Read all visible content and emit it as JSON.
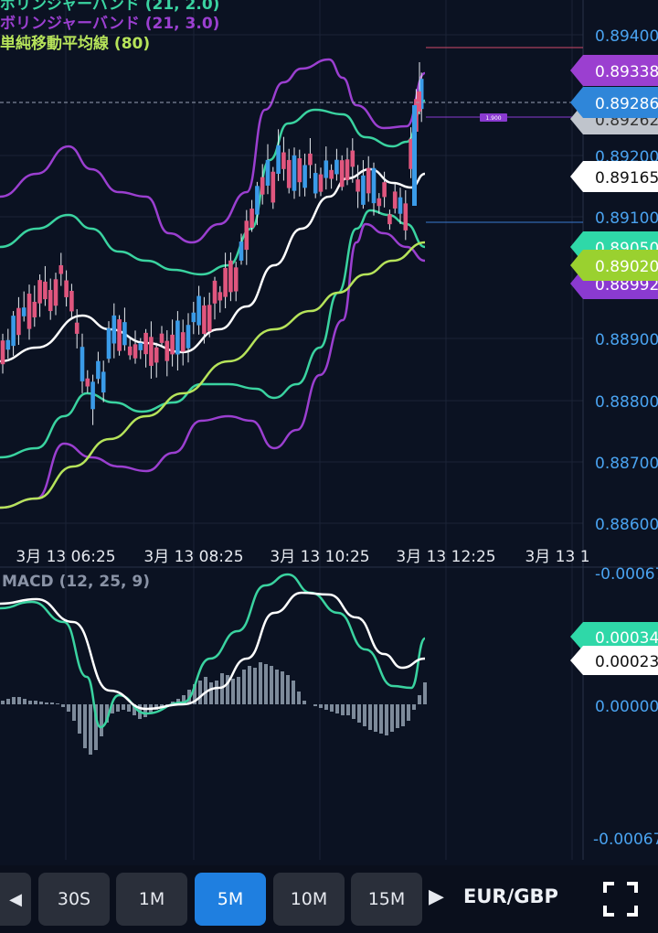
{
  "indicators": {
    "bb1": "ボリンジャーバンド (21, 2.0)",
    "bb2": "ボリンジャーバンド (21, 3.0)",
    "sma": "単純移動平均線 (80)",
    "macd": "MACD (12, 25, 9)"
  },
  "colors": {
    "bb2": "#3ad3a0",
    "bb3": "#9b3fd0",
    "mid": "#ffffff",
    "sma": "#b6e35a",
    "up": "#3a9be8",
    "down": "#e0567e",
    "macd": "#3ad3a0",
    "signal": "#ffffff",
    "hist": "#7d8a9a"
  },
  "chart_data": {
    "type": "line",
    "y_ticks": [
      "0.89400",
      "0.89200",
      "0.89100",
      "0.88900",
      "0.88800",
      "0.88700",
      "0.88600"
    ],
    "x_ticks": [
      "3月 13 06:25",
      "3月 13 08:25",
      "3月 13 10:25",
      "3月 13 12:25",
      "3月 13 1"
    ],
    "price_tags": [
      {
        "value": "0.89338",
        "bg": "#9b3fd0",
        "fg": "#ffffff"
      },
      {
        "value": "0.89286",
        "bg": "#2f86d9",
        "fg": "#ffffff"
      },
      {
        "value": "0.89262",
        "bg": "#bfc4cc",
        "fg": "#333333"
      },
      {
        "value": "0.89165",
        "bg": "#ffffff",
        "fg": "#111111"
      },
      {
        "value": "0.89050",
        "bg": "#2fd8a8",
        "fg": "#ffffff"
      },
      {
        "value": "0.89020",
        "bg": "#9ad12f",
        "fg": "#ffffff"
      },
      {
        "value": "0.88992",
        "bg": "#8a3ad0",
        "fg": "#ffffff"
      }
    ],
    "marker_label": "1.900",
    "macd_ticks": [
      "-0.00067",
      "0.00000",
      "-0.00067"
    ],
    "macd_tags": [
      {
        "value": "0.00034",
        "bg": "#2fd8a8",
        "fg": "#ffffff"
      },
      {
        "value": "0.00023",
        "bg": "#ffffff",
        "fg": "#111111"
      }
    ]
  },
  "toolbar": {
    "timeframes": [
      "30S",
      "1M",
      "5M",
      "10M",
      "15M"
    ],
    "active": "5M",
    "pair": "EUR/GBP"
  }
}
